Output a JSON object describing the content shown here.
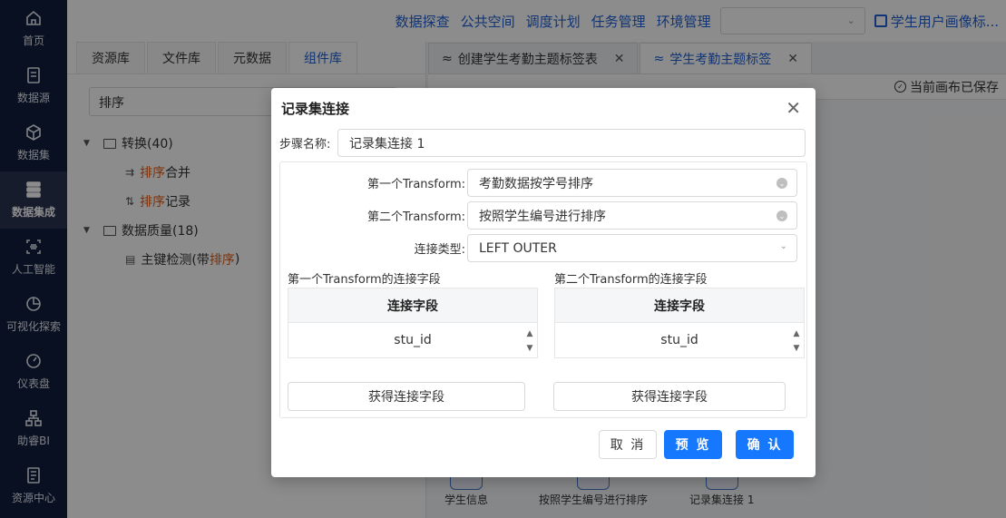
{
  "sidebar": {
    "items": [
      {
        "label": "首页",
        "icon": "home-icon"
      },
      {
        "label": "数据源",
        "icon": "database-icon"
      },
      {
        "label": "数据集",
        "icon": "cube-icon"
      },
      {
        "label": "数据集成",
        "icon": "server-icon",
        "active": true
      },
      {
        "label": "人工智能",
        "icon": "ai-scan-icon"
      },
      {
        "label": "可视化探索",
        "icon": "pie-chart-icon"
      },
      {
        "label": "仪表盘",
        "icon": "gauge-icon"
      },
      {
        "label": "助睿BI",
        "icon": "network-icon"
      },
      {
        "label": "资源中心",
        "icon": "document-icon"
      }
    ]
  },
  "topbar": {
    "nav": [
      "数据探查",
      "公共空间",
      "调度计划",
      "任务管理",
      "环境管理"
    ],
    "select_value": "",
    "user_link": "学生用户画像标..."
  },
  "left_panel": {
    "tabs": [
      "资源库",
      "文件库",
      "元数据",
      "组件库"
    ],
    "active_tab": "组件库",
    "search_value": "排序",
    "tree": {
      "group1": {
        "label": "转换(40)"
      },
      "leaf1": {
        "hl": "排序",
        "rest": " 合并"
      },
      "leaf2": {
        "hl": "排序",
        "rest": " 记录"
      },
      "group2": {
        "label": "数据质量(18)"
      },
      "leaf3": {
        "pre": "主键检测(带 ",
        "hl": "排序",
        "post": " )"
      }
    }
  },
  "canvas": {
    "tabs": [
      {
        "label": "创建学生考勤主题标签表"
      },
      {
        "label": "学生考勤主题标签",
        "active": true
      }
    ],
    "saved_status": "当前画布已保存",
    "nodes": [
      "学生信息",
      "按照学生编号进行排序",
      "记录集连接 1"
    ]
  },
  "modal": {
    "title": "记录集连接",
    "step_name_label": "步骤名称:",
    "step_name_value": "记录集连接 1",
    "first_transform_label": "第一个Transform:",
    "first_transform_value": "考勤数据按学号排序",
    "second_transform_label": "第二个Transform:",
    "second_transform_value": "按照学生编号进行排序",
    "join_type_label": "连接类型:",
    "join_type_value": "LEFT OUTER",
    "first_fields_title": "第一个Transform的连接字段",
    "second_fields_title": "第二个Transform的连接字段",
    "first_table": {
      "header": "连接字段",
      "rows": [
        "stu_id"
      ]
    },
    "second_table": {
      "header": "连接字段",
      "rows": [
        "stu_id"
      ]
    },
    "get_fields_label": "获得连接字段",
    "cancel_label": "取 消",
    "preview_label": "预 览",
    "confirm_label": "确 认"
  },
  "colors": {
    "primary": "#1677ff",
    "sidebar_bg": "#0f1e3c",
    "link": "#1e5fd6",
    "highlight": "#e05a10"
  }
}
